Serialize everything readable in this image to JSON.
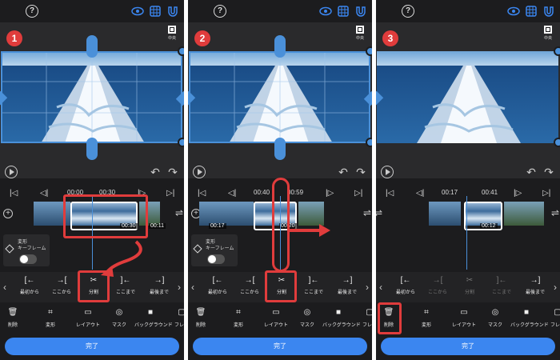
{
  "colors": {
    "accent": "#3b86f0",
    "annotation": "#e03c3c",
    "background": "#1c1c1e"
  },
  "panels": [
    {
      "step": "1",
      "fit_label": "中央",
      "time_left": "00:00",
      "time_right": "00:30",
      "clip_duration": "00:30",
      "side_duration_left": "",
      "side_duration_right": "00:11",
      "keyframe": {
        "title": "変形",
        "sub": "キーフレーム"
      },
      "actions": [
        {
          "label": "最初から",
          "icon": "[←",
          "dim": false
        },
        {
          "label": "ここから",
          "icon": "→[",
          "dim": false
        },
        {
          "label": "分割",
          "icon": "✂",
          "dim": false
        },
        {
          "label": "ここまで",
          "icon": "]←",
          "dim": false
        },
        {
          "label": "最後まで",
          "icon": "→]",
          "dim": false
        }
      ],
      "tools": [
        {
          "label": "削除",
          "icon": "🗑"
        },
        {
          "label": "変形",
          "icon": "⌗"
        },
        {
          "label": "レイアウト",
          "icon": "▭"
        },
        {
          "label": "マスク",
          "icon": "◎"
        },
        {
          "label": "バックグラウンド",
          "icon": "■"
        },
        {
          "label": "フレー",
          "icon": "▢"
        }
      ],
      "done_label": "完了"
    },
    {
      "step": "2",
      "fit_label": "中央",
      "time_left": "00:40",
      "time_right": "00:59",
      "clip_duration": "00:20",
      "side_duration_left": "00:17",
      "side_duration_right": "",
      "keyframe": {
        "title": "変形",
        "sub": "キーフレーム"
      },
      "actions": [
        {
          "label": "最初から",
          "icon": "[←",
          "dim": false
        },
        {
          "label": "ここから",
          "icon": "→[",
          "dim": false
        },
        {
          "label": "分割",
          "icon": "✂",
          "dim": false
        },
        {
          "label": "ここまで",
          "icon": "]←",
          "dim": false
        },
        {
          "label": "最後まで",
          "icon": "→]",
          "dim": false
        }
      ],
      "tools": [
        {
          "label": "削除",
          "icon": "🗑"
        },
        {
          "label": "変形",
          "icon": "⌗"
        },
        {
          "label": "レイアウト",
          "icon": "▭"
        },
        {
          "label": "マスク",
          "icon": "◎"
        },
        {
          "label": "バックグラウンド",
          "icon": "■"
        },
        {
          "label": "フレー",
          "icon": "▢"
        }
      ],
      "done_label": "完了"
    },
    {
      "step": "3",
      "fit_label": "中央",
      "time_left": "00:17",
      "time_right": "00:41",
      "clip_duration": "00:12",
      "side_duration_left": "",
      "side_duration_right": "",
      "keyframe": {
        "title": "",
        "sub": ""
      },
      "actions": [
        {
          "label": "最初から",
          "icon": "[←",
          "dim": false
        },
        {
          "label": "ここから",
          "icon": "→[",
          "dim": true
        },
        {
          "label": "分割",
          "icon": "✂",
          "dim": true
        },
        {
          "label": "ここまで",
          "icon": "]←",
          "dim": true
        },
        {
          "label": "最後まで",
          "icon": "→]",
          "dim": false
        }
      ],
      "tools": [
        {
          "label": "削除",
          "icon": "🗑"
        },
        {
          "label": "変形",
          "icon": "⌗"
        },
        {
          "label": "レイアウト",
          "icon": "▭"
        },
        {
          "label": "マスク",
          "icon": "◎"
        },
        {
          "label": "バックグラウンド",
          "icon": "■"
        },
        {
          "label": "フレー",
          "icon": "▢"
        }
      ],
      "done_label": "完了"
    }
  ]
}
